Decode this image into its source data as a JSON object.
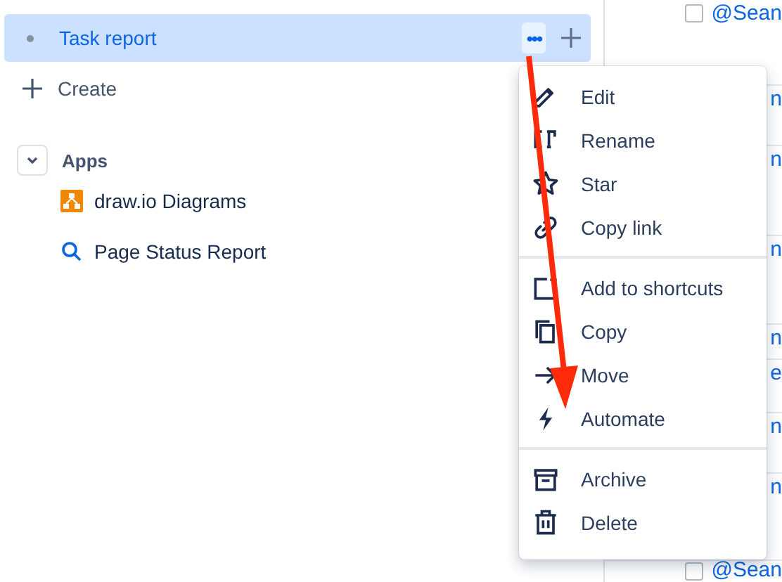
{
  "sidebar": {
    "items": [
      {
        "kind": "page",
        "label": "Task report",
        "selected": true,
        "actions": {
          "more": "•••"
        }
      }
    ],
    "create": "Create",
    "apps_section": {
      "title": "Apps",
      "expanded": true,
      "items": [
        {
          "kind": "drawio",
          "label": "draw.io Diagrams"
        },
        {
          "kind": "search",
          "label": "Page Status Report"
        }
      ]
    }
  },
  "background_table": {
    "rows": [
      {
        "checked": false,
        "mention": "@Sean"
      },
      {
        "mention": "n"
      },
      {
        "mention": "n"
      },
      {
        "mention": "n"
      },
      {
        "mention": "n"
      },
      {
        "mention": "e"
      },
      {
        "mention": "n"
      },
      {
        "mention": "n"
      },
      {
        "checked": false,
        "mention": "@Sean"
      }
    ]
  },
  "context_menu": {
    "groups": [
      [
        {
          "label": "Edit"
        },
        {
          "label": "Rename"
        },
        {
          "label": "Star"
        },
        {
          "label": "Copy link"
        }
      ],
      [
        {
          "label": "Add to shortcuts"
        },
        {
          "label": "Copy"
        },
        {
          "label": "Move"
        },
        {
          "label": "Automate"
        }
      ],
      [
        {
          "label": "Archive"
        },
        {
          "label": "Delete"
        }
      ]
    ]
  },
  "annotation": {
    "kind": "arrow"
  }
}
